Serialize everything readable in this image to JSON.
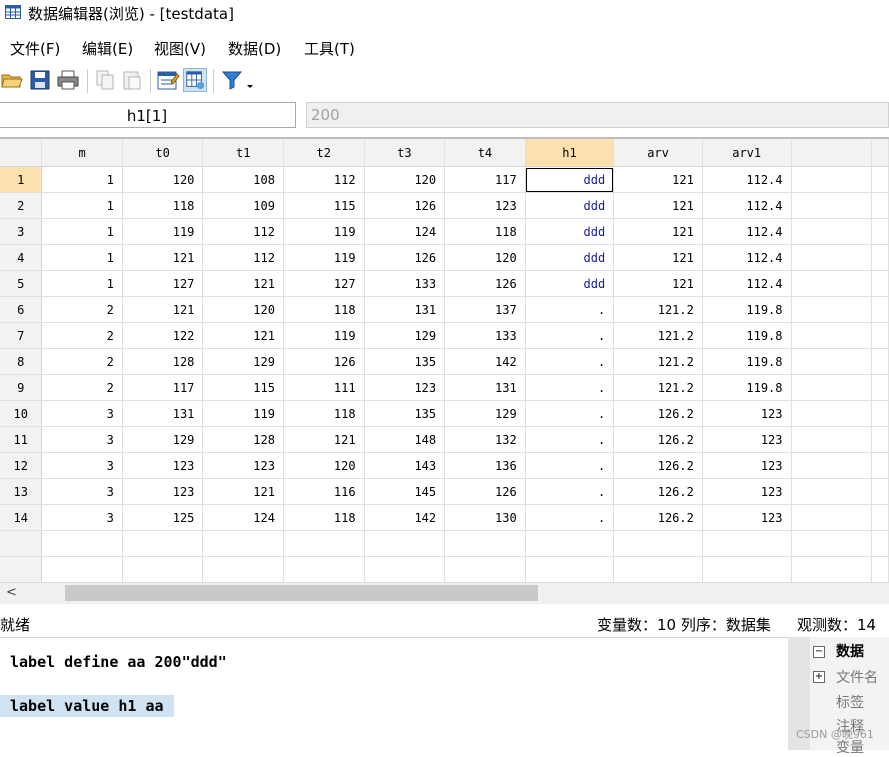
{
  "window": {
    "title": "数据编辑器(浏览) - [testdata]"
  },
  "menu": [
    "文件(F)",
    "编辑(E)",
    "视图(V)",
    "数据(D)",
    "工具(T)"
  ],
  "toolbar": [
    "open-icon",
    "save-icon",
    "print-icon",
    "copy-icon",
    "paste-icon",
    "variables-manager-icon",
    "data-editor-edit-icon",
    "filter-icon",
    "dropdown-arrow-icon"
  ],
  "editbar": {
    "current_cell": "h1[1]",
    "value": "200"
  },
  "grid": {
    "columns": [
      "m",
      "t0",
      "t1",
      "t2",
      "t3",
      "t4",
      "h1",
      "arv",
      "arv1"
    ],
    "rows": [
      [
        "1",
        "1",
        "120",
        "108",
        "112",
        "120",
        "117",
        "ddd",
        "121",
        "112.4"
      ],
      [
        "2",
        "1",
        "118",
        "109",
        "115",
        "126",
        "123",
        "ddd",
        "121",
        "112.4"
      ],
      [
        "3",
        "1",
        "119",
        "112",
        "119",
        "124",
        "118",
        "ddd",
        "121",
        "112.4"
      ],
      [
        "4",
        "1",
        "121",
        "112",
        "119",
        "126",
        "120",
        "ddd",
        "121",
        "112.4"
      ],
      [
        "5",
        "1",
        "127",
        "121",
        "127",
        "133",
        "126",
        "ddd",
        "121",
        "112.4"
      ],
      [
        "6",
        "2",
        "121",
        "120",
        "118",
        "131",
        "137",
        ".",
        "121.2",
        "119.8"
      ],
      [
        "7",
        "2",
        "122",
        "121",
        "119",
        "129",
        "133",
        ".",
        "121.2",
        "119.8"
      ],
      [
        "8",
        "2",
        "128",
        "129",
        "126",
        "135",
        "142",
        ".",
        "121.2",
        "119.8"
      ],
      [
        "9",
        "2",
        "117",
        "115",
        "111",
        "123",
        "131",
        ".",
        "121.2",
        "119.8"
      ],
      [
        "10",
        "3",
        "131",
        "119",
        "118",
        "135",
        "129",
        ".",
        "126.2",
        "123"
      ],
      [
        "11",
        "3",
        "129",
        "128",
        "121",
        "148",
        "132",
        ".",
        "126.2",
        "123"
      ],
      [
        "12",
        "3",
        "123",
        "123",
        "120",
        "143",
        "136",
        ".",
        "126.2",
        "123"
      ],
      [
        "13",
        "3",
        "123",
        "121",
        "116",
        "145",
        "126",
        ".",
        "126.2",
        "123"
      ],
      [
        "14",
        "3",
        "125",
        "124",
        "118",
        "142",
        "130",
        ".",
        "126.2",
        "123"
      ]
    ]
  },
  "statusbar": {
    "ready": "就绪",
    "vars": "变量数：10  列序：数据集",
    "obs": "观测数：14"
  },
  "commands": [
    "label define aa 200\"ddd\"",
    "label value h1 aa"
  ],
  "right_panel": {
    "header": "数据",
    "items": [
      "文件名",
      "标签",
      "注释",
      "变量"
    ]
  },
  "watermark": "CSDN @晚961",
  "colors": {
    "selected_header": "#fbe0b0",
    "label_text": "#1a1aa0",
    "command_highlight": "#cfe3f3"
  }
}
